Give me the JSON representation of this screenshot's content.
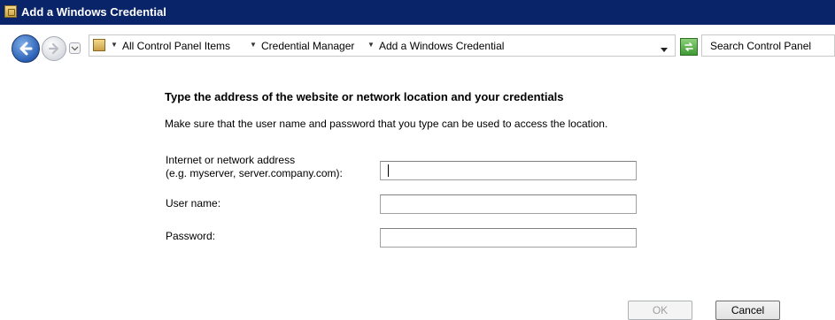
{
  "window": {
    "title": "Add a Windows Credential"
  },
  "nav": {
    "breadcrumbs": [
      "All Control Panel Items",
      "Credential Manager",
      "Add a Windows Credential"
    ],
    "search_placeholder": "Search Control Panel"
  },
  "content": {
    "heading": "Type the address of the website or network location and your credentials",
    "description": "Make sure that the user name and password that you type can be used to access the location.",
    "address_label_line1": "Internet or network address",
    "address_label_line2": "(e.g. myserver, server.company.com):",
    "username_label": "User name:",
    "password_label": "Password:",
    "address_value": "",
    "username_value": "",
    "password_value": ""
  },
  "buttons": {
    "ok": "OK",
    "cancel": "Cancel"
  },
  "state": {
    "ok_enabled": false
  }
}
